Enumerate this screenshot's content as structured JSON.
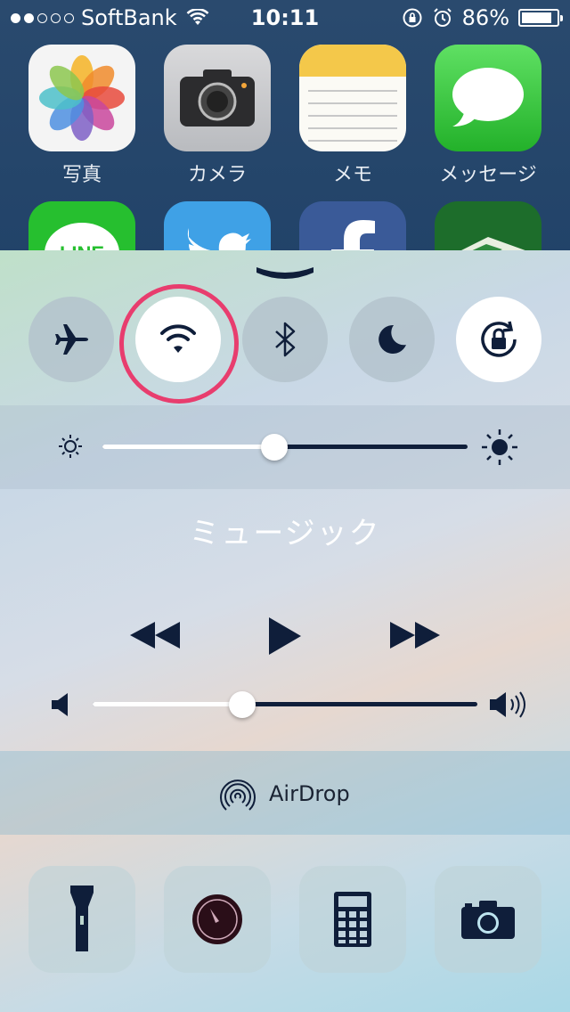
{
  "status_bar": {
    "signal_dots": [
      true,
      true,
      false,
      false,
      false
    ],
    "carrier": "SoftBank",
    "time": "10:11",
    "battery_percent": "86%",
    "battery_level": 0.86
  },
  "home_screen": {
    "apps": [
      {
        "label": "写真",
        "icon": "photos-icon"
      },
      {
        "label": "カメラ",
        "icon": "camera-icon"
      },
      {
        "label": "メモ",
        "icon": "notes-icon"
      },
      {
        "label": "メッセージ",
        "icon": "messages-icon"
      }
    ],
    "partial_apps": [
      {
        "icon": "line-icon",
        "text": "LINE"
      },
      {
        "icon": "twitter-icon"
      },
      {
        "icon": "facebook-icon"
      },
      {
        "icon": "game-icon"
      }
    ]
  },
  "control_center": {
    "toggles": [
      {
        "name": "airplane-mode",
        "active": false
      },
      {
        "name": "wifi",
        "active": true,
        "highlighted": true
      },
      {
        "name": "bluetooth",
        "active": false
      },
      {
        "name": "do-not-disturb",
        "active": false
      },
      {
        "name": "rotation-lock",
        "active": true
      }
    ],
    "brightness_level": 0.47,
    "music": {
      "title": "ミュージック"
    },
    "volume_level": 0.39,
    "airdrop_label": "AirDrop",
    "shortcuts": [
      "flashlight",
      "timer",
      "calculator",
      "camera"
    ]
  },
  "colors": {
    "highlight_ring": "#e83d6e",
    "icon_dark": "#0f1e3a"
  }
}
